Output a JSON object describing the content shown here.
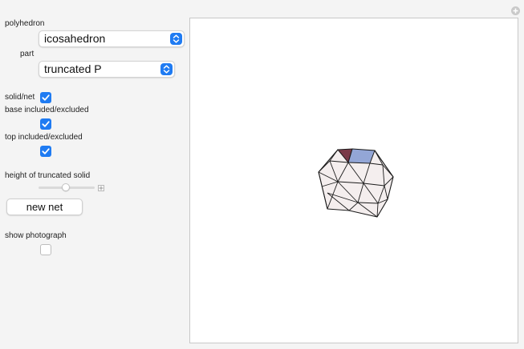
{
  "controls": {
    "polyhedron_label": "polyhedron",
    "polyhedron_value": "icosahedron",
    "part_label": "part",
    "part_value": "truncated P",
    "solid_net_label": "solid/net",
    "solid_net_checked": true,
    "base_label": "base included/excluded",
    "base_checked": true,
    "top_label": "top included/excluded",
    "top_checked": true,
    "height_label": "height of truncated solid",
    "height_value_fraction": 0.49,
    "new_net_label": "new net",
    "photo_label": "show photograph",
    "photo_checked": false
  },
  "colors": {
    "accent": "#1f7bf2",
    "face_fill": "#f4eeee",
    "top_face_red": "#7a3a48",
    "top_face_blue": "#93a6d6"
  },
  "icons": {
    "stepper": "up-down-chevron-icon",
    "checkmark": "checkmark-icon",
    "plus": "plus-icon",
    "corner": "plus-circle-icon"
  }
}
